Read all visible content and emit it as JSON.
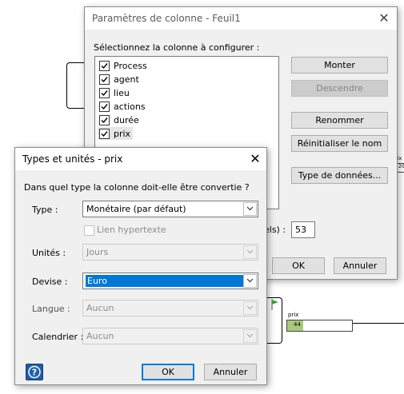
{
  "column_dialog": {
    "title": "Paramètres de colonne - Feuil1",
    "select_label": "Sélectionnez la colonne à configurer :",
    "columns": [
      {
        "label": "Process",
        "checked": true
      },
      {
        "label": "agent",
        "checked": true
      },
      {
        "label": "lieu",
        "checked": true
      },
      {
        "label": "actions",
        "checked": true
      },
      {
        "label": "durée",
        "checked": true
      },
      {
        "label": "prix",
        "checked": true
      }
    ],
    "buttons": {
      "up": "Monter",
      "down": "Descendre",
      "rename": "Renommer",
      "reset_name": "Réinitialiser le nom",
      "data_type": "Type de données...",
      "ok": "OK",
      "cancel": "Annuler"
    },
    "width_label_partial": "els) :",
    "width_value": "53"
  },
  "types_dialog": {
    "title": "Types et unités - prix",
    "question": "Dans quel type la colonne doit-elle être convertie ?",
    "type_label": "Type :",
    "type_value": "Monétaire (par défaut)",
    "hyperlink_label": "Lien hypertexte",
    "units_label": "Unités :",
    "units_value": "Jours",
    "currency_label": "Devise :",
    "currency_value": "Euro",
    "language_label": "Langue :",
    "language_value": "Aucun",
    "calendar_label": "Calendrier :",
    "calendar_value": "Aucun",
    "ok": "OK",
    "cancel": "Annuler"
  },
  "canvas": {
    "shape_label": "prix",
    "shape_value": "44",
    "edge_label": "ix",
    "edge_value": "20"
  },
  "colors": {
    "accent": "#0078d7",
    "value_fill": "#a9c97a",
    "flag": "#3aa43a"
  }
}
